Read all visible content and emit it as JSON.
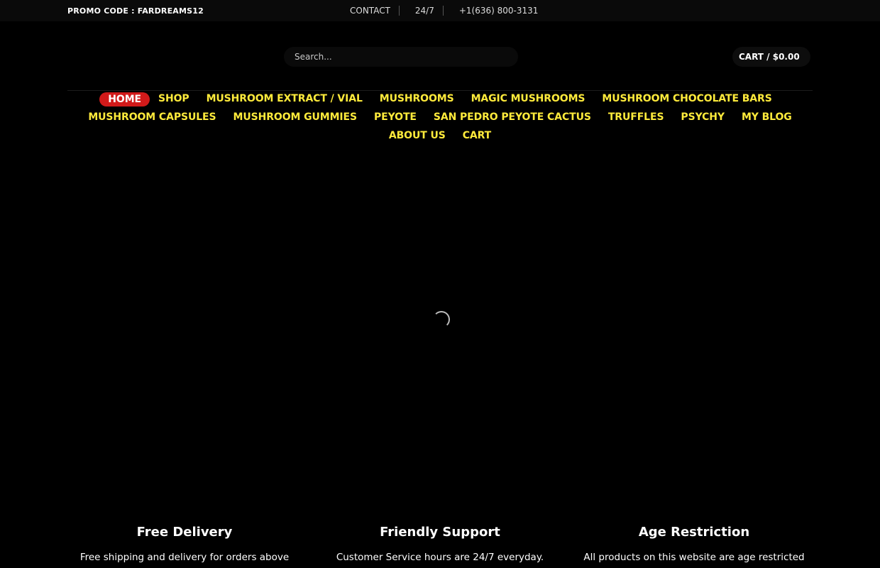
{
  "topbar": {
    "promo": "PROMO CODE : FARDREAMS12",
    "links": [
      "CONTACT",
      "24/7",
      "+1(636) 800-3131"
    ]
  },
  "header": {
    "search_placeholder": "Search...",
    "cart_label": "CART / $0.00"
  },
  "nav": {
    "items": [
      "HOME",
      "SHOP",
      "MUSHROOM EXTRACT / VIAL",
      "MUSHROOMS",
      "MAGIC MUSHROOMS",
      "MUSHROOM CHOCOLATE BARS",
      "MUSHROOM CAPSULES",
      "MUSHROOM GUMMIES",
      "PEYOTE",
      "SAN PEDRO PEYOTE CACTUS",
      "TRUFFLES",
      "PSYCHY",
      "MY BLOG",
      "ABOUT US",
      "CART"
    ],
    "active": "HOME"
  },
  "features": [
    {
      "title": "Free Delivery",
      "text": "Free shipping and delivery for orders above"
    },
    {
      "title": "Friendly Support",
      "text": "Customer Service hours are 24/7 everyday."
    },
    {
      "title": "Age Restriction",
      "text": "All products on this website are age restricted"
    }
  ],
  "colors": {
    "background": "#000000",
    "nav_text": "#ffeb3b",
    "active_pill": "#d11a1a"
  }
}
